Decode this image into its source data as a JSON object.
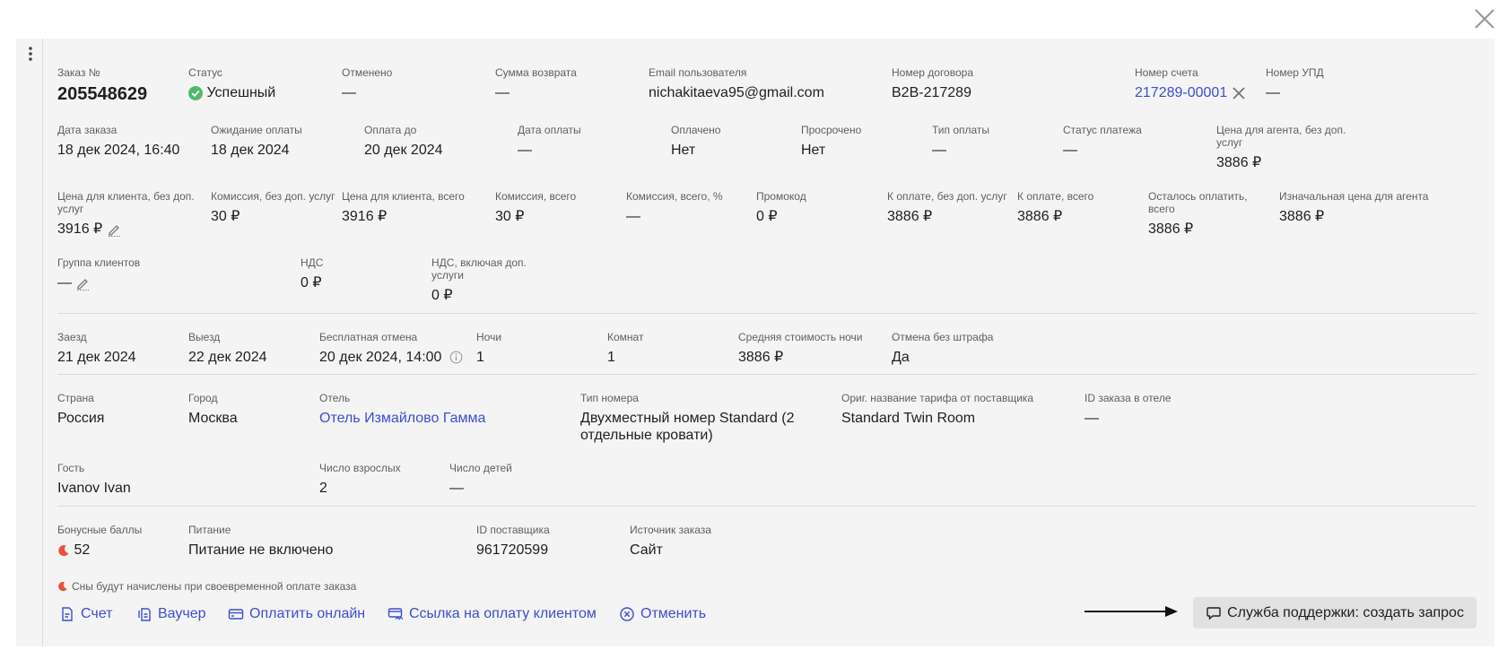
{
  "order": {
    "number_label": "Заказ №",
    "number": "205548629",
    "status_label": "Статус",
    "status": "Успешный",
    "cancelled_label": "Отменено",
    "cancelled": "—",
    "refund_label": "Сумма возврата",
    "refund": "—",
    "email_label": "Email пользователя",
    "email": "nichakitaeva95@gmail.com",
    "contract_label": "Номер договора",
    "contract": "B2B-217289",
    "invoice_label": "Номер счета",
    "invoice": "217289-00001",
    "upd_label": "Номер УПД",
    "upd": "—"
  },
  "payment": {
    "order_date_label": "Дата заказа",
    "order_date": "18 дек 2024, 16:40",
    "awaiting_label": "Ожидание оплаты",
    "awaiting": "18 дек 2024",
    "pay_until_label": "Оплата до",
    "pay_until": "20 дек 2024",
    "pay_date_label": "Дата оплаты",
    "pay_date": "—",
    "paid_label": "Оплачено",
    "paid": "Нет",
    "overdue_label": "Просрочено",
    "overdue": "Нет",
    "pay_type_label": "Тип оплаты",
    "pay_type": "—",
    "pay_status_label": "Статус платежа",
    "pay_status": "—",
    "agent_price_label": "Цена для агента, без доп. услуг",
    "agent_price": "3886 ₽"
  },
  "prices": {
    "client_price_label": "Цена для клиента, без доп. услуг",
    "client_price": "3916 ₽",
    "commission_label": "Комиссия, без доп. услуг",
    "commission": "30 ₽",
    "client_total_label": "Цена для клиента, всего",
    "client_total": "3916 ₽",
    "commission_total_label": "Комиссия, всего",
    "commission_total": "30 ₽",
    "commission_pct_label": "Комиссия, всего, %",
    "commission_pct": "—",
    "promo_label": "Промокод",
    "promo": "0 ₽",
    "to_pay_label": "К оплате, без доп. услуг",
    "to_pay": "3886 ₽",
    "to_pay_total_label": "К оплате, всего",
    "to_pay_total": "3886 ₽",
    "remaining_label": "Осталось оплатить, всего",
    "remaining": "3886 ₽",
    "initial_label": "Изначальная цена для агента",
    "initial": "3886 ₽"
  },
  "groups": {
    "client_group_label": "Группа клиентов",
    "client_group": "—",
    "vat_label": "НДС",
    "vat": "0 ₽",
    "vat_incl_label": "НДС, включая доп. услуги",
    "vat_incl": "0 ₽"
  },
  "stay": {
    "checkin_label": "Заезд",
    "checkin": "21 дек 2024",
    "checkout_label": "Выезд",
    "checkout": "22 дек 2024",
    "free_cancel_label": "Бесплатная отмена",
    "free_cancel": "20 дек 2024, 14:00",
    "nights_label": "Ночи",
    "nights": "1",
    "rooms_label": "Комнат",
    "rooms": "1",
    "avg_label": "Средняя стоимость ночи",
    "avg": "3886 ₽",
    "no_penalty_label": "Отмена без штрафа",
    "no_penalty": "Да"
  },
  "hotel": {
    "country_label": "Страна",
    "country": "Россия",
    "city_label": "Город",
    "city": "Москва",
    "hotel_label": "Отель",
    "hotel": "Отель Измайлово Гамма",
    "room_type_label": "Тип номера",
    "room_type": "Двухместный номер Standard (2 отдельные кровати)",
    "orig_rate_label": "Ориг. название тарифа от поставщика",
    "orig_rate": "Standard Twin Room",
    "hotel_order_id_label": "ID заказа в отеле",
    "hotel_order_id": "—"
  },
  "guests": {
    "guest_label": "Гость",
    "guest": "Ivanov Ivan",
    "adults_label": "Число взрослых",
    "adults": "2",
    "children_label": "Число детей",
    "children": "—"
  },
  "extra": {
    "bonus_label": "Бонусные баллы",
    "bonus": "52",
    "meal_label": "Питание",
    "meal": "Питание не включено",
    "supplier_id_label": "ID поставщика",
    "supplier_id": "961720599",
    "source_label": "Источник заказа",
    "source": "Сайт",
    "bonus_note": "Сны будут начислены при своевременной оплате заказа"
  },
  "actions": {
    "invoice": "Счет",
    "voucher": "Ваучер",
    "pay_online": "Оплатить онлайн",
    "client_link": "Ссылка на оплату клиентом",
    "cancel": "Отменить",
    "support": "Служба поддержки: создать запрос"
  },
  "colors": {
    "accent": "#3a4fd1",
    "success": "#52b96a",
    "bonus": "#e8533f",
    "panel": "#f4f4f4"
  }
}
